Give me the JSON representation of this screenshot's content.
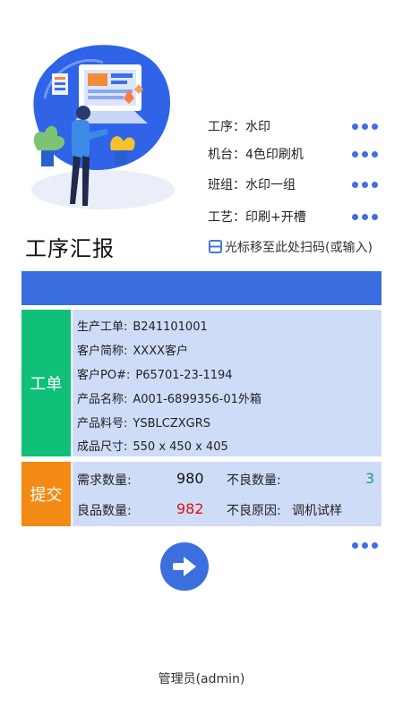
{
  "info": [
    {
      "label": "工序：水印"
    },
    {
      "label": "机台：4色印刷机"
    },
    {
      "label": "班组：水印一组"
    },
    {
      "label": "工艺：印刷+开槽"
    }
  ],
  "page_title": "工序汇报",
  "scan_hint": "光标移至此处扫码(或输入)",
  "work_order": {
    "section_label": "工单",
    "fields": [
      {
        "key": "生产工单:",
        "value": "B241101001"
      },
      {
        "key": "客户简称:",
        "value": "XXXX客户"
      },
      {
        "key": "客户PO#:",
        "value": "P65701-23-1194"
      },
      {
        "key": "产品名称:",
        "value": "A001-6899356-01外箱"
      },
      {
        "key": "产品料号:",
        "value": "YSBLCZXGRS"
      },
      {
        "key": "成品尺寸:",
        "value": "550 x 450 x 405"
      }
    ]
  },
  "submit": {
    "section_label": "提交",
    "demand_label": "需求数量:",
    "demand_value": "980",
    "defect_label": "不良数量:",
    "defect_value": "3",
    "good_label": "良品数量:",
    "good_value": "982",
    "reason_label": "不良原因:",
    "reason_value": "调机试样"
  },
  "footer_user": "管理员(admin)",
  "colors": {
    "accent": "#3a6ee0",
    "work_order_tag": "#10c078",
    "submit_tag": "#f38a14",
    "panel_bg": "#cfdcf8",
    "good_value": "#e01010",
    "defect_value": "#18a070"
  },
  "icons": {
    "row_more": "ellipsis-icon",
    "scan": "scan-icon",
    "go": "arrow-right-icon"
  }
}
